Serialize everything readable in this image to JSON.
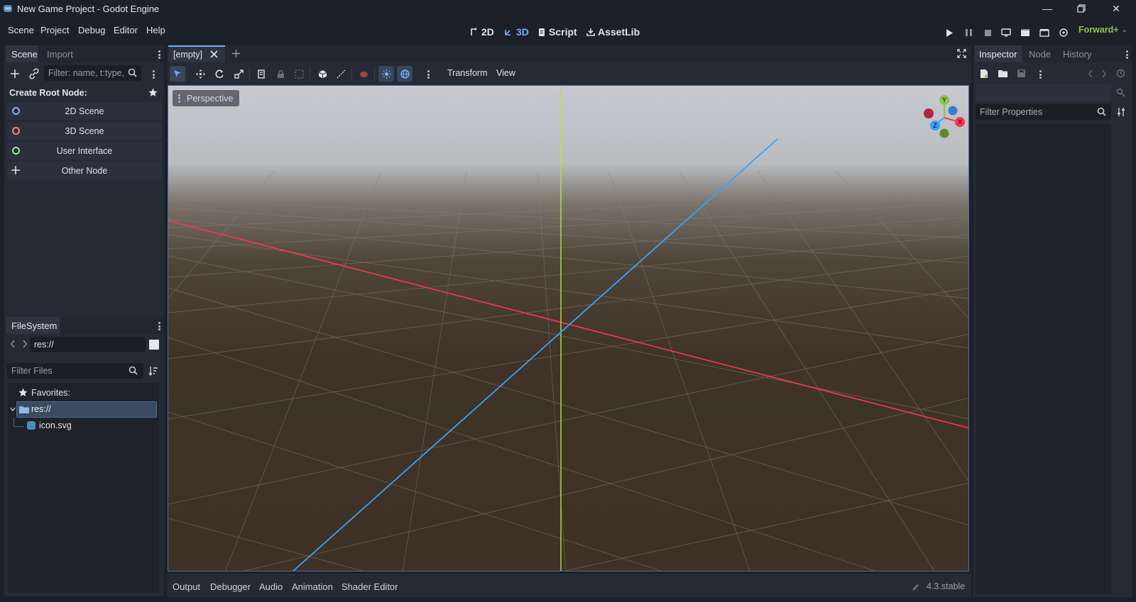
{
  "window": {
    "title": "New Game Project - Godot Engine",
    "controls": [
      "minimize",
      "restore",
      "close"
    ]
  },
  "menu": {
    "items": [
      "Scene",
      "Project",
      "Debug",
      "Editor",
      "Help"
    ]
  },
  "workspaces": [
    {
      "label": "2D",
      "icon": "2d-workspace-icon"
    },
    {
      "label": "3D",
      "icon": "3d-workspace-icon",
      "active": true
    },
    {
      "label": "Script",
      "icon": "script-icon"
    },
    {
      "label": "AssetLib",
      "icon": "assetlib-icon"
    }
  ],
  "renderer": {
    "label": "Forward+"
  },
  "scene_dock": {
    "tabs": [
      "Scene",
      "Import"
    ],
    "filter_placeholder": "Filter: name, t:type, ",
    "create_root_label": "Create Root Node:",
    "root_nodes": [
      {
        "label": "2D Scene",
        "color": "#8da5f3"
      },
      {
        "label": "3D Scene",
        "color": "#fc7f7f"
      },
      {
        "label": "User Interface",
        "color": "#8eef97"
      },
      {
        "label": "Other Node",
        "color": "#e0e0e0"
      }
    ]
  },
  "filesystem": {
    "tab": "FileSystem",
    "path": "res://",
    "filter_placeholder": "Filter Files",
    "favorites_label": "Favorites:",
    "root_label": "res://",
    "files": [
      {
        "name": "icon.svg"
      }
    ]
  },
  "viewport": {
    "scene_tab": "[empty]",
    "toolbar_menus": [
      "Transform",
      "View"
    ],
    "perspective_label": "Perspective",
    "gizmo": {
      "x": "X",
      "y": "Y",
      "z": "Z"
    },
    "colors": {
      "ground": "#3e3326",
      "sky": "#c8ccd2",
      "x_axis": "#ff3355",
      "y_axis": "#b8e04a",
      "z_axis": "#3aa0ff"
    }
  },
  "bottom_panel": {
    "tabs": [
      "Output",
      "Debugger",
      "Audio",
      "Animation",
      "Shader Editor"
    ],
    "version": "4.3.stable"
  },
  "inspector": {
    "tabs": [
      "Inspector",
      "Node",
      "History"
    ],
    "filter_placeholder": "Filter Properties"
  }
}
